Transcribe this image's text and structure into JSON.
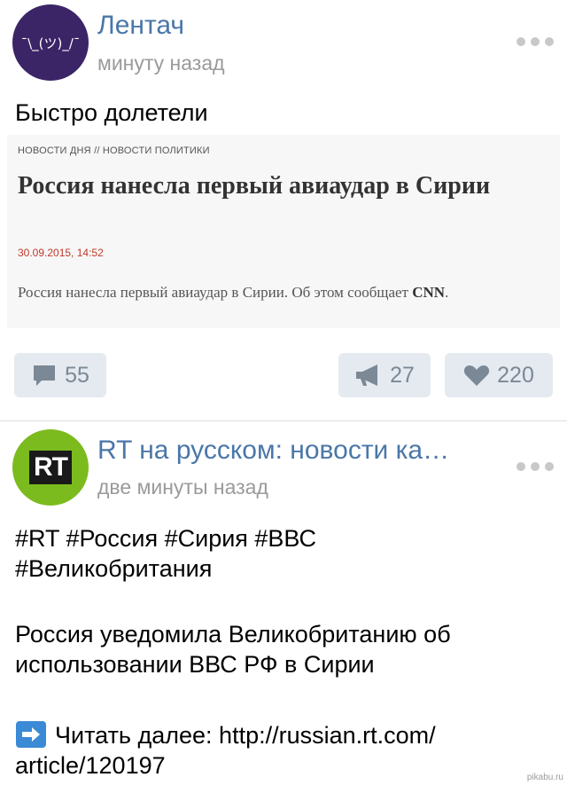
{
  "posts": [
    {
      "source": "Лентач",
      "time": "минуту назад",
      "avatar_text": "¯\\_(ツ)_/¯",
      "text": "Быстро долетели",
      "embed": {
        "breadcrumb": "НОВОСТИ ДНЯ  //  НОВОСТИ ПОЛИТИКИ",
        "headline": "Россия нанесла первый авиаудар в Сирии",
        "date": "30.09.2015, 14:52",
        "summary_text": "Россия нанесла первый авиаудар в Сирии. Об этом сообщает ",
        "summary_source": "CNN",
        "summary_end": "."
      },
      "comments": "55",
      "reposts": "27",
      "likes": "220"
    },
    {
      "source": "RT на русском: новости ка…",
      "time": "две минуты назад",
      "avatar_text": "RT",
      "lines": [
        "#RT #Россия #Сирия #ВВС",
        "#Великобритания",
        "Россия уведомила Великобританию об",
        "использовании ВВС РФ в Сирии",
        "Читать далее: http://russian.rt.com/",
        "article/120197"
      ]
    }
  ],
  "watermark": "pikabu.ru",
  "colors": {
    "link": "#4a77a8",
    "meta": "#9a9a9a",
    "button_bg": "#e5eaf0",
    "button_fg": "#7b8896",
    "avatar1_bg": "#3b2566",
    "avatar2_bg": "#7cbb1e",
    "date_red": "#c0392b"
  }
}
